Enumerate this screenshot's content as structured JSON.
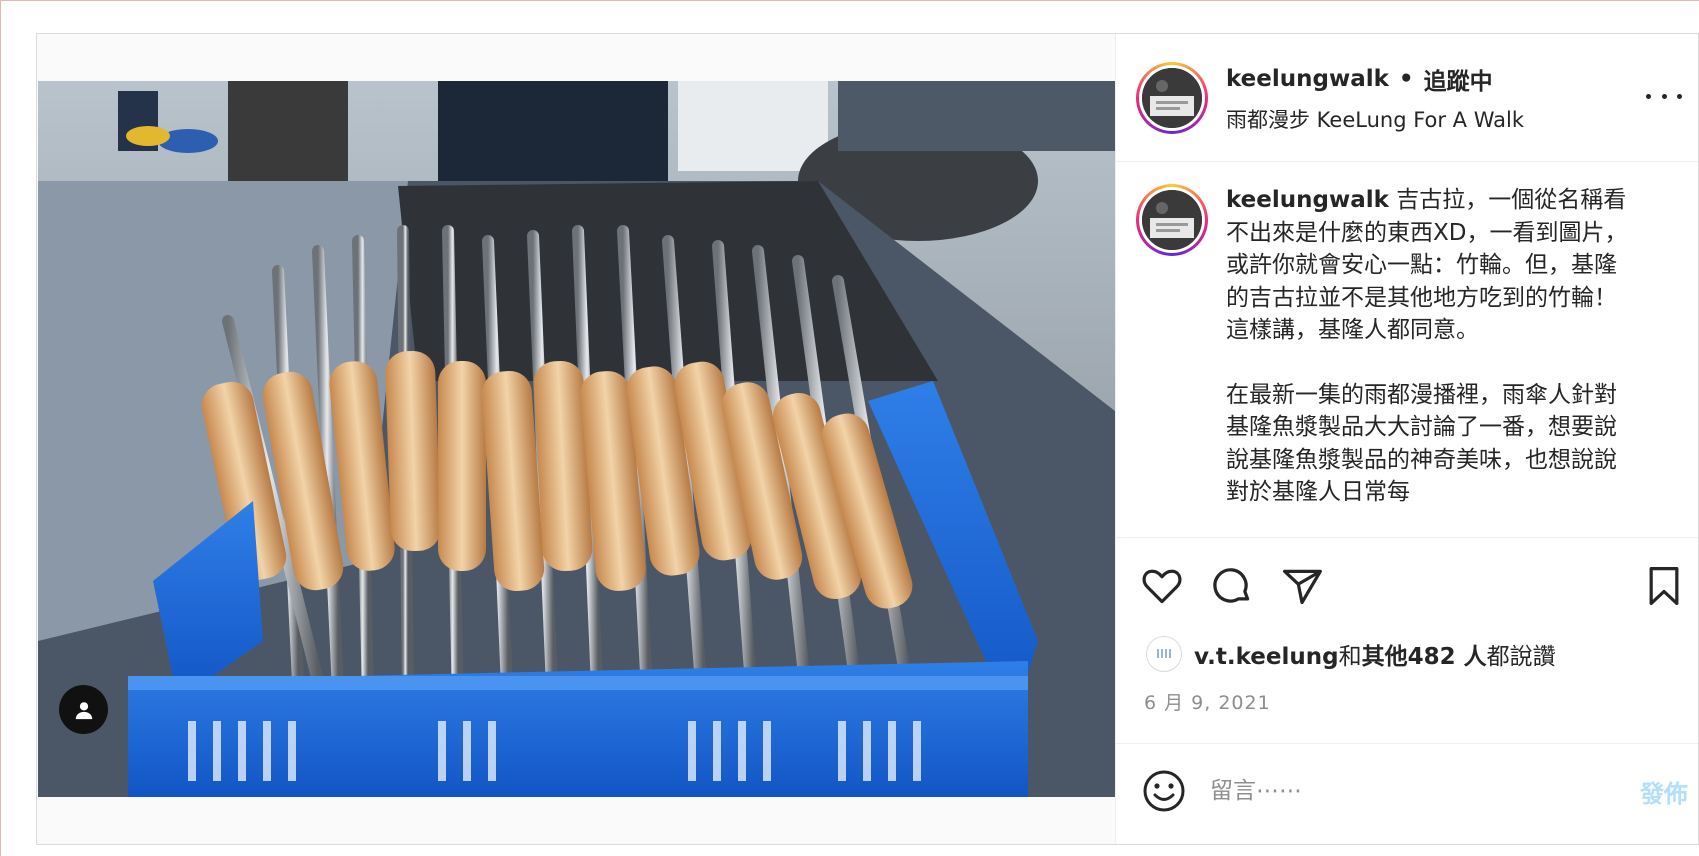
{
  "post": {
    "username": "keelungwalk",
    "separator": "•",
    "follow_status": "追蹤中",
    "subtitle": "雨都漫步 KeeLung For A Walk",
    "caption": {
      "username": "keelungwalk",
      "paragraph1": " 吉古拉，一個從名稱看不出來是什麼的東西XD，一看到圖片，或許你就會安心一點：竹輪。但，基隆的吉古拉並不是其他地方吃到的竹輪！這樣講，基隆人都同意。",
      "paragraph2": "在最新一集的雨都漫播裡，雨傘人針對基隆魚漿製品大大討論了一番，想要說說基隆魚漿製品的神奇美味，也想說說對於基隆人日常每"
    },
    "likes": {
      "user": "v.t.keelung",
      "connector": "和",
      "others": "其他482 人",
      "suffix": "都說讚"
    },
    "date": "6 月 9, 2021"
  },
  "comment": {
    "placeholder": "留言⋯⋯",
    "post_label": "發佈"
  },
  "icons": {
    "like": "heart-icon",
    "comment": "comment-bubble-icon",
    "share": "paper-plane-icon",
    "save": "bookmark-icon",
    "more": "more-options-icon",
    "emoji": "emoji-icon",
    "user_tag": "user-tag-icon"
  },
  "colors": {
    "post_button_disabled": "#b2dffc",
    "secondary_text": "#8e8e8e",
    "border": "#dbdbdb"
  }
}
